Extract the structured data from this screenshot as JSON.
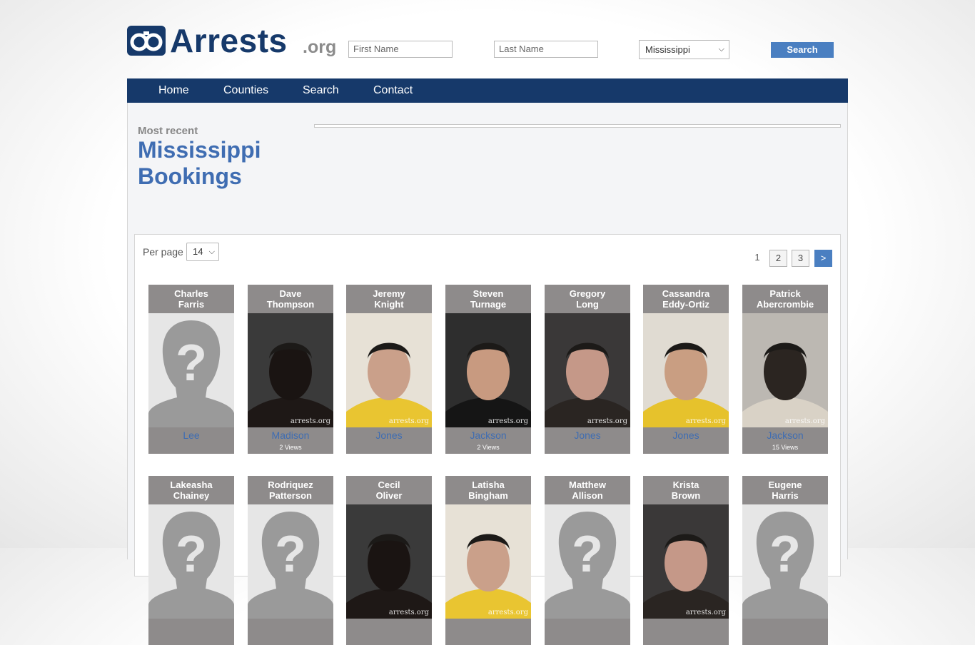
{
  "site": {
    "name": "Arrests",
    "tld": ".org"
  },
  "search": {
    "first_name_placeholder": "First Name",
    "last_name_placeholder": "Last Name",
    "state_value": "Mississippi",
    "button_label": "Search"
  },
  "nav": {
    "items": [
      "Home",
      "Counties",
      "Search",
      "Contact"
    ]
  },
  "heading": {
    "kicker": "Most recent",
    "title": "Mississippi Bookings"
  },
  "list": {
    "per_page_label": "Per page",
    "per_page_value": "14",
    "pagination": {
      "current": "1",
      "pages": [
        "2",
        "3"
      ],
      "next": ">"
    },
    "watermark": "arrests.org",
    "bookings": [
      {
        "first": "Charles",
        "last": "Farris",
        "county": "Lee",
        "views": "",
        "photo": "placeholder"
      },
      {
        "first": "Dave",
        "last": "Thompson",
        "county": "Madison",
        "views": "2 Views",
        "photo": "mugshot"
      },
      {
        "first": "Jeremy",
        "last": "Knight",
        "county": "Jones",
        "views": "",
        "photo": "mugshot"
      },
      {
        "first": "Steven",
        "last": "Turnage",
        "county": "Jackson",
        "views": "2 Views",
        "photo": "mugshot"
      },
      {
        "first": "Gregory",
        "last": "Long",
        "county": "Jones",
        "views": "",
        "photo": "mugshot"
      },
      {
        "first": "Cassandra",
        "last": "Eddy-Ortiz",
        "county": "Jones",
        "views": "",
        "photo": "mugshot"
      },
      {
        "first": "Patrick",
        "last": "Abercrombie",
        "county": "Jackson",
        "views": "15 Views",
        "photo": "mugshot"
      },
      {
        "first": "Lakeasha",
        "last": "Chainey",
        "county": "",
        "views": "",
        "photo": "placeholder"
      },
      {
        "first": "Rodriquez",
        "last": "Patterson",
        "county": "",
        "views": "",
        "photo": "placeholder"
      },
      {
        "first": "Cecil",
        "last": "Oliver",
        "county": "",
        "views": "",
        "photo": "mugshot"
      },
      {
        "first": "Latisha",
        "last": "Bingham",
        "county": "",
        "views": "",
        "photo": "mugshot"
      },
      {
        "first": "Matthew",
        "last": "Allison",
        "county": "",
        "views": "",
        "photo": "placeholder"
      },
      {
        "first": "Krista",
        "last": "Brown",
        "county": "",
        "views": "",
        "photo": "mugshot"
      },
      {
        "first": "Eugene",
        "last": "Harris",
        "county": "",
        "views": "",
        "photo": "placeholder"
      }
    ]
  },
  "colors": {
    "brand": "#16396a",
    "accent": "#4a7fc1",
    "card": "#8e8b8b",
    "link": "#3f6db2"
  }
}
